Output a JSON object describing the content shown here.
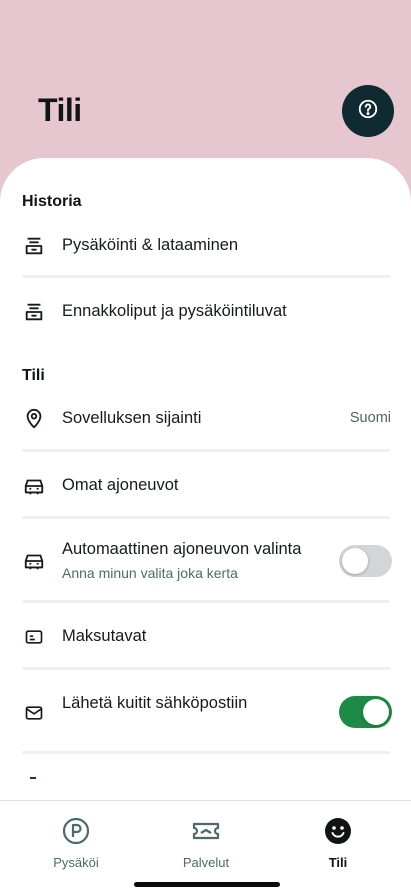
{
  "header": {
    "title": "Tili",
    "help_icon": "question-circle-icon"
  },
  "sections": {
    "history_title": "Historia",
    "account_title": "Tili"
  },
  "history_items": [
    {
      "label": "Pysäköinti & lataaminen",
      "icon": "receipt-icon"
    },
    {
      "label": "Ennakkoliput ja pysäköintiluvat",
      "icon": "receipt-icon"
    }
  ],
  "account_items": {
    "location": {
      "label": "Sovelluksen sijainti",
      "value": "Suomi",
      "icon": "location-pin-icon"
    },
    "vehicles": {
      "label": "Omat ajoneuvot",
      "icon": "car-icon"
    },
    "auto_vehicle": {
      "label": "Automaattinen ajoneuvon valinta",
      "sub": "Anna minun valita joka kerta",
      "icon": "car-icon",
      "enabled": false
    },
    "payment": {
      "label": "Maksutavat",
      "icon": "card-icon"
    },
    "email_receipts": {
      "label": "Lähetä kuitit sähköpostiin",
      "icon": "mail-icon",
      "enabled": true
    }
  },
  "colors": {
    "header_bg": "#e6c7cf",
    "help_btn": "#0f2a30",
    "toggle_on": "#1d8a45",
    "toggle_off": "#d3d6d8"
  },
  "tabs": [
    {
      "label": "Pysäköi",
      "icon": "parking-icon",
      "active": false
    },
    {
      "label": "Palvelut",
      "icon": "ticket-icon",
      "active": false
    },
    {
      "label": "Tili",
      "icon": "smiley-icon",
      "active": true
    }
  ]
}
